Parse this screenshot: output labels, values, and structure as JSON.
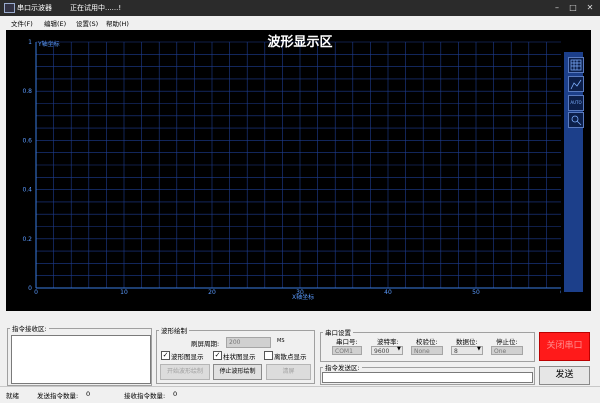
{
  "window": {
    "app_title": "串口示波器",
    "status_title": "正在试用中......!",
    "controls": {
      "minimize": "–",
      "maximize": "□",
      "close": "✕"
    }
  },
  "menu": [
    "文件(F)",
    "编辑(E)",
    "设置(S)",
    "帮助(H)"
  ],
  "chart_data": {
    "type": "line",
    "title": "波形显示区",
    "xlabel": "X轴坐标",
    "ylabel": "Y轴坐标",
    "xlim": [
      0,
      60
    ],
    "ylim": [
      0,
      1
    ],
    "x_ticks": [
      "0",
      "10",
      "20",
      "30",
      "40",
      "50",
      "60"
    ],
    "y_ticks": [
      "0",
      "0.2",
      "0.4",
      "0.6",
      "0.8",
      "1"
    ],
    "series": [],
    "grid": true,
    "colors": {
      "background": "#000000",
      "grid": "#1e3d8f",
      "axis": "#3a7be0",
      "title": "#ffffff",
      "tick_label": "#5b9bff"
    }
  },
  "sidebar_icons": [
    "grid-icon",
    "chart-icon",
    "auto-icon",
    "zoom-icon"
  ],
  "sidebar_auto_label": "AUTO",
  "receive_group": {
    "label": "指令接收区:"
  },
  "waveform_group": {
    "label": "波形绘制",
    "refresh_label": "刷屏周期:",
    "refresh_value": "200",
    "refresh_unit": "MS",
    "checkboxes": [
      {
        "label": "波形图显示",
        "checked": true
      },
      {
        "label": "柱状图显示",
        "checked": true
      },
      {
        "label": "离散点显示",
        "checked": false
      }
    ],
    "buttons": [
      {
        "label": "开始波形绘制",
        "enabled": false
      },
      {
        "label": "停止波形绘制",
        "enabled": true
      },
      {
        "label": "清屏",
        "enabled": false
      }
    ]
  },
  "serial_group": {
    "label": "串口设置",
    "fields": [
      {
        "label": "串口号:",
        "value": "COM1"
      },
      {
        "label": "波特率:",
        "value": "9600"
      },
      {
        "label": "校验位:",
        "value": "None"
      },
      {
        "label": "数据位:",
        "value": "8"
      },
      {
        "label": "停止位:",
        "value": "One"
      }
    ]
  },
  "close_port_button": {
    "label": "关闭串口",
    "color": "#ff1a1a"
  },
  "send_group": {
    "label": "指令发送区:",
    "value": ""
  },
  "send_button": {
    "label": "发送"
  },
  "status_bar": {
    "ready": "就绪",
    "sent_label": "发送指令数量:",
    "sent_count": "0",
    "received_label": "接收指令数量:",
    "received_count": "0"
  }
}
